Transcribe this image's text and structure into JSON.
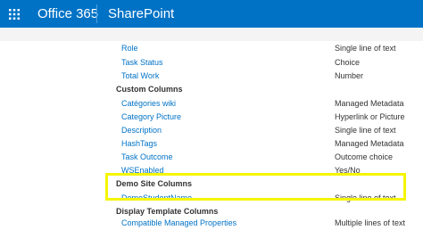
{
  "suite_bar": {
    "brand": "Office 365",
    "app_name": "SharePoint"
  },
  "site_columns": [
    {
      "kind": "column",
      "name": "Role",
      "type": "Single line of text"
    },
    {
      "kind": "column",
      "name": "Task Status",
      "type": "Choice"
    },
    {
      "kind": "column",
      "name": "Total Work",
      "type": "Number"
    },
    {
      "kind": "group",
      "name": "Custom Columns"
    },
    {
      "kind": "column",
      "name": "Catégories wiki",
      "type": "Managed Metadata"
    },
    {
      "kind": "column",
      "name": "Category Picture",
      "type": "Hyperlink or Picture"
    },
    {
      "kind": "column",
      "name": "Description",
      "type": "Single line of text"
    },
    {
      "kind": "column",
      "name": "HashTags",
      "type": "Managed Metadata"
    },
    {
      "kind": "column",
      "name": "Task Outcome",
      "type": "Outcome choice"
    },
    {
      "kind": "column",
      "name": "WSEnabled",
      "type": "Yes/No"
    },
    {
      "kind": "group",
      "name": "Demo Site Columns"
    },
    {
      "kind": "column",
      "name": "DemoStudentName",
      "type": "Single line of text"
    },
    {
      "kind": "group",
      "name": "Display Template Columns"
    },
    {
      "kind": "column",
      "name": "Compatible Managed Properties",
      "type": "Multiple lines of text"
    }
  ],
  "highlight": {
    "color": "#f5f500",
    "group": "Demo Site Columns"
  },
  "colors": {
    "suite_bar": "#0072c6",
    "link": "#0072c6",
    "text": "#333333"
  }
}
